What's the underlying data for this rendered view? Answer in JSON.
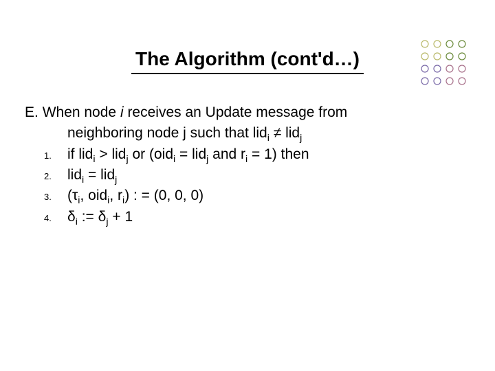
{
  "title": "The Algorithm (cont'd…)",
  "section_label": "E.",
  "intro_part1": "When node ",
  "intro_node": "i",
  "intro_part2": " receives an Update message from",
  "intro_line2_a": "neighboring node j such that lid",
  "intro_line2_b": " ≠ lid",
  "steps": {
    "s1": {
      "num": "1.",
      "a": "if lid",
      "b": " > lid",
      "c": " or (oid",
      "d": " = lid",
      "e": " and r",
      "f": " = 1) then"
    },
    "s2": {
      "num": "2.",
      "a": "lid",
      "b": " = lid"
    },
    "s3": {
      "num": "3.",
      "a": "(τ",
      "b": ", oid",
      "c": ", r",
      "d": ") : = (0, 0, 0)"
    },
    "s4": {
      "num": "4.",
      "a": "δ",
      "b": " := δ",
      "c": " + 1"
    }
  },
  "sub_i": "i",
  "sub_j": "j",
  "dot_colors": {
    "c1": "#b9b96a",
    "c2": "#6a8a3a",
    "c3": "#7a6aa8",
    "c4": "#a8708a"
  }
}
